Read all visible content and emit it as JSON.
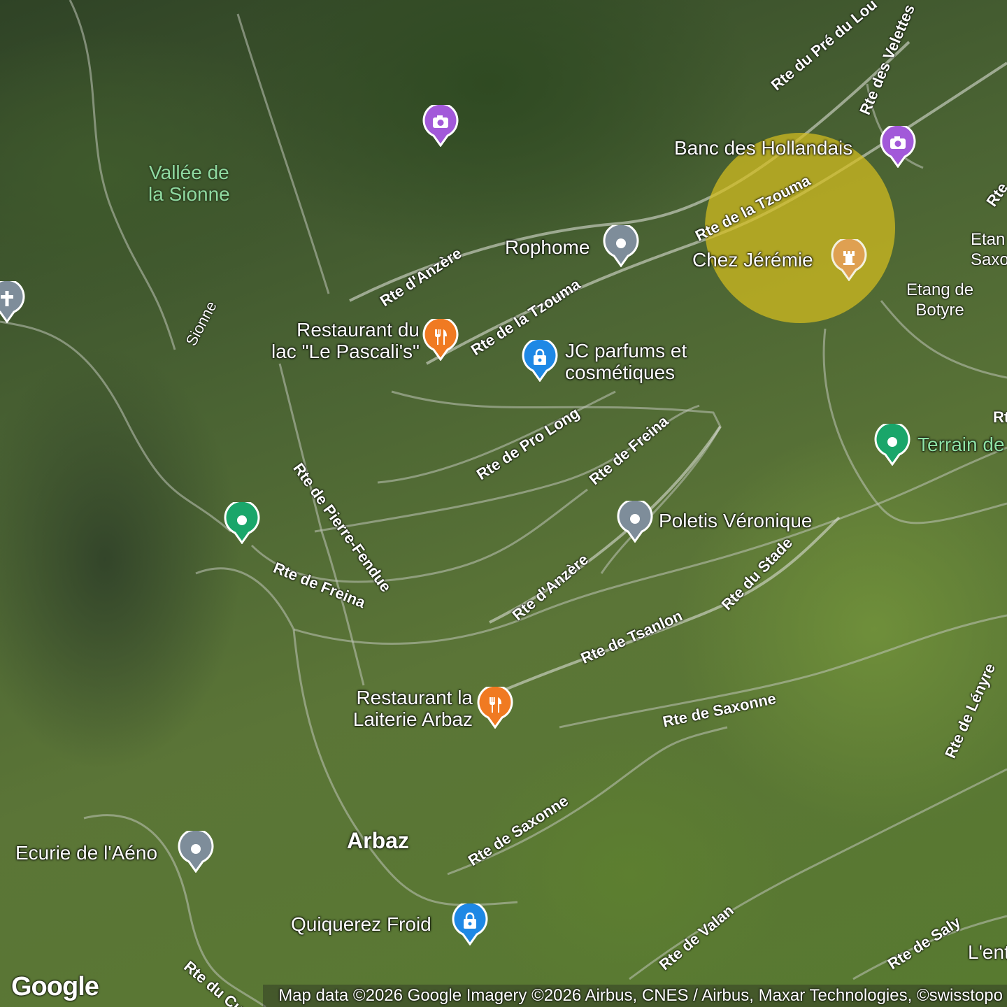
{
  "map": {
    "type": "satellite",
    "area_labels": {
      "valley": "Vallée de\nla Sionne",
      "river": "Sionne",
      "etang_saxonne": "Etan\nSaxo",
      "etang_botyre": "Etang de\nBotyre",
      "town": "Arbaz",
      "lentre": "L'ent"
    },
    "roads": {
      "pre_du_lou": "Rte du Pré du Lou",
      "velettes": "Rte des Velettes",
      "tzouma_top": "Rte de la Tzouma",
      "anzere_top": "Rte d'Anzère",
      "tzouma_mid": "Rte de la Tzouma",
      "pro_long": "Rte de Pro Long",
      "freina_east": "Rte de Freina",
      "pierre_fendue": "Rte de Pierre-Fendue",
      "freina_west": "Rte de Freina",
      "anzere_mid": "Rte d'Anzère",
      "stade": "Rte du Stade",
      "tsanlon": "Rte de Tsanlon",
      "saxonne_east": "Rte de Saxonne",
      "lenyre": "Rte de Lényre",
      "saxonne_south": "Rte de Saxonne",
      "valan": "Rte de Valan",
      "saly": "Rte de Saly",
      "cudre": "Rte du Cudre",
      "edge_r1": "Rte",
      "edge_r2": "Rt"
    },
    "places": [
      {
        "id": "photo-1",
        "label": "",
        "category": "photo",
        "color": "#a259d9"
      },
      {
        "id": "banc",
        "label": "Banc des Hollandais",
        "category": "photo",
        "color": "#a259d9"
      },
      {
        "id": "rophome",
        "label": "Rophome",
        "category": "generic",
        "color": "#7e8d9a"
      },
      {
        "id": "chez-jeremie",
        "label": "Chez Jérémie",
        "category": "landmark",
        "color": "#e8a05a"
      },
      {
        "id": "cross",
        "label": "",
        "category": "church",
        "color": "#7e8d9a"
      },
      {
        "id": "pascalis",
        "label": "Restaurant du\nlac \"Le Pascali's\"",
        "category": "restaurant",
        "color": "#f07a22"
      },
      {
        "id": "jc-parfums",
        "label": "JC parfums et\ncosmétiques",
        "category": "shopping",
        "color": "#1e88e5"
      },
      {
        "id": "terrain",
        "label": "Terrain de",
        "category": "park",
        "color": "#1aa66a"
      },
      {
        "id": "green-pin",
        "label": "",
        "category": "park",
        "color": "#1aa66a"
      },
      {
        "id": "poletis",
        "label": "Poletis Véronique",
        "category": "generic",
        "color": "#7e8d9a"
      },
      {
        "id": "laiterie",
        "label": "Restaurant la\nLaiterie Arbaz",
        "category": "restaurant",
        "color": "#f07a22"
      },
      {
        "id": "ecurie",
        "label": "Ecurie de l'Aéno",
        "category": "generic",
        "color": "#7e8d9a"
      },
      {
        "id": "quiquerez",
        "label": "Quiquerez Froid",
        "category": "shopping",
        "color": "#1e88e5"
      }
    ],
    "highlight": {
      "color": "#d6be1e"
    },
    "attribution": "Map data ©2026 Google Imagery ©2026 Airbus, CNES / Airbus, Maxar Technologies, ©swisstopo",
    "logo": "Google"
  }
}
